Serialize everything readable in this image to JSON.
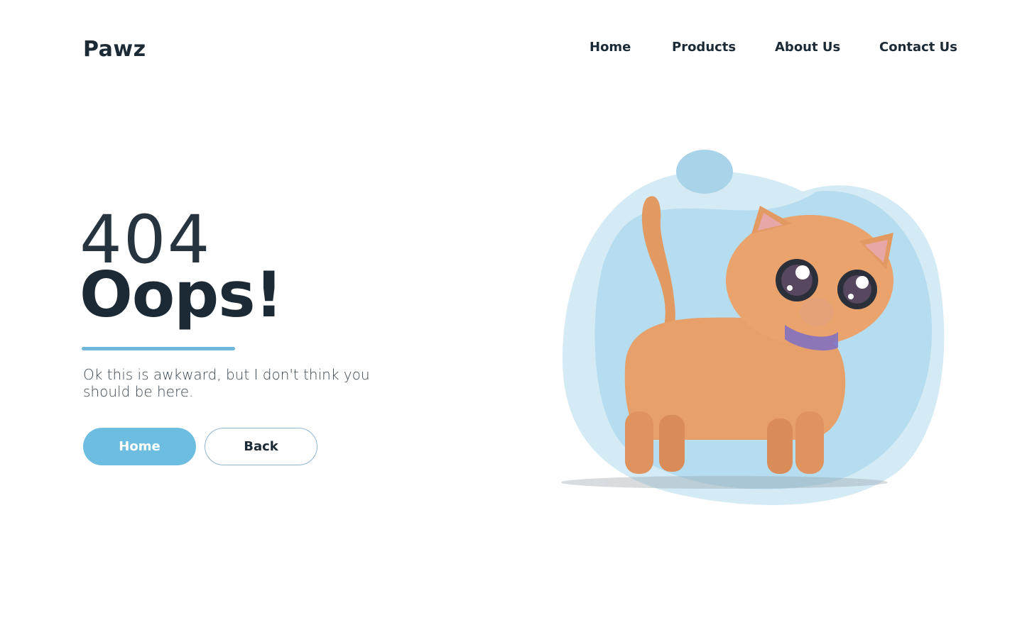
{
  "header": {
    "logo": "Pawz",
    "nav": [
      "Home",
      "Products",
      "About Us",
      "Contact Us"
    ]
  },
  "hero": {
    "code": "404",
    "headline": "Oops!",
    "message": "Ok this is awkward, but I don't think you should be here.",
    "buttons": {
      "home": "Home",
      "back": "Back"
    }
  },
  "colors": {
    "accent": "#6cbde0",
    "text": "#1b2a35",
    "blob_light": "#d4eaf5",
    "blob_mid": "#b5ddef",
    "cat_body": "#e39a62"
  },
  "illustration": "cartoon-cat"
}
